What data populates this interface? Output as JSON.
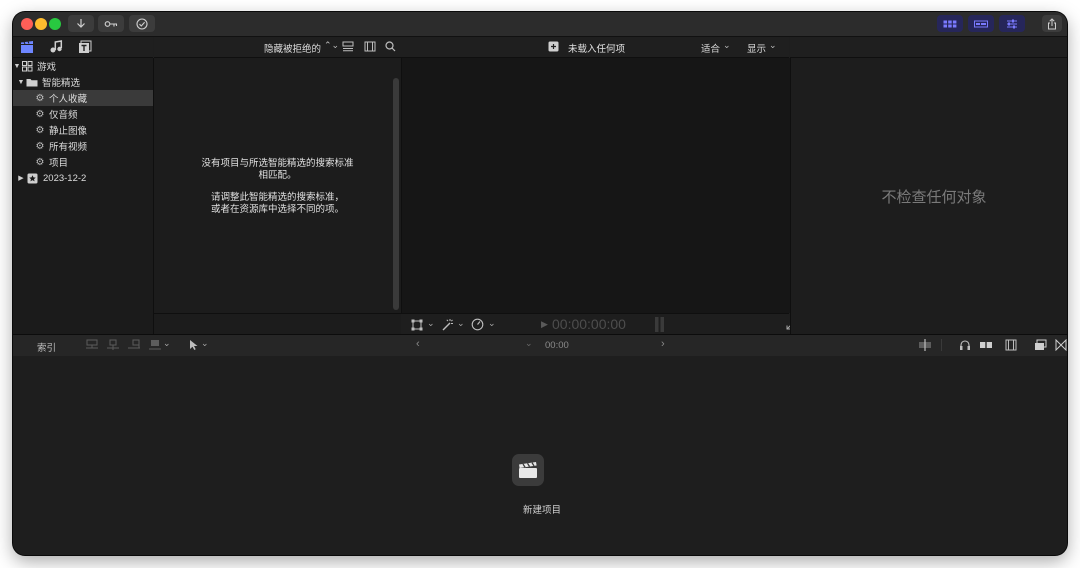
{
  "toolbar": {
    "import_icon": "download-arrow-icon",
    "keyword_icon": "key-icon",
    "check_icon": "checkmark-circle-icon",
    "share_icon": "share-icon"
  },
  "browser": {
    "filter_label": "隐藏被拒绝的",
    "empty_line1": "没有项目与所选智能精选的搜索标准",
    "empty_line2": "相匹配。",
    "empty_line3": "请调整此智能精选的搜索标准，",
    "empty_line4": "或者在资源库中选择不同的项。"
  },
  "sidebar": {
    "library": "游戏",
    "smart_collections": "智能精选",
    "items": [
      {
        "label": "个人收藏",
        "selected": true
      },
      {
        "label": "仅音频",
        "selected": false
      },
      {
        "label": "静止图像",
        "selected": false
      },
      {
        "label": "所有视频",
        "selected": false
      },
      {
        "label": "项目",
        "selected": false
      }
    ],
    "event": "2023-12-2"
  },
  "viewer": {
    "title": "未载入任何项",
    "fit_label": "适合",
    "display_label": "显示",
    "timecode": "00:00:00:00"
  },
  "inspector": {
    "empty": "不检查任何对象"
  },
  "timeline": {
    "index_label": "索引",
    "timecode": "00:00",
    "new_project_label": "新建项目"
  },
  "colors": {
    "accent_toolbar_button": "#26265a",
    "selection": "#3a3a3a"
  }
}
